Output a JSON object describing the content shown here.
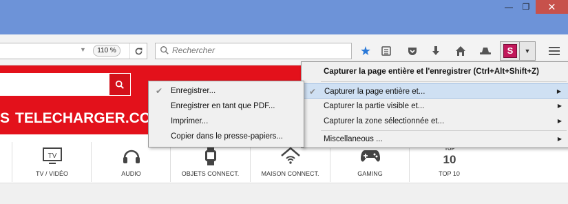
{
  "window": {
    "minimize_glyph": "—",
    "maximize_glyph": "❐",
    "close_glyph": "✕"
  },
  "toolbar": {
    "zoom": "110 %",
    "search_placeholder": "Rechercher",
    "extension_logo": "S"
  },
  "site": {
    "title": "TELECHARGER.COM",
    "title_prefix": "S",
    "categories": [
      {
        "label": "TV / VIDÉO",
        "icon": "tv-icon"
      },
      {
        "label": "AUDIO",
        "icon": "headphones-icon"
      },
      {
        "label": "OBJETS CONNECT.",
        "icon": "smartwatch-icon"
      },
      {
        "label": "MAISON CONNECT.",
        "icon": "smart-home-icon"
      },
      {
        "label": "GAMING",
        "icon": "gamepad-icon"
      },
      {
        "label": "TOP 10",
        "icon": "top10-icon"
      }
    ]
  },
  "main_menu": {
    "header": "Capturer la page entière et l'enregistrer (Ctrl+Alt+Shift+Z)",
    "items": [
      "Capturer la page entière et...",
      "Capturer la partie visible et...",
      "Capturer la zone sélectionnée et...",
      "Miscellaneous ..."
    ]
  },
  "sub_menu": {
    "items": [
      "Enregistrer...",
      "Enregistrer en tant que PDF...",
      "Imprimer...",
      "Copier dans le presse-papiers..."
    ]
  },
  "colors": {
    "titlebar": "#6d93d8",
    "brand_red": "#e3111b",
    "highlight": "#cfe0f3"
  }
}
